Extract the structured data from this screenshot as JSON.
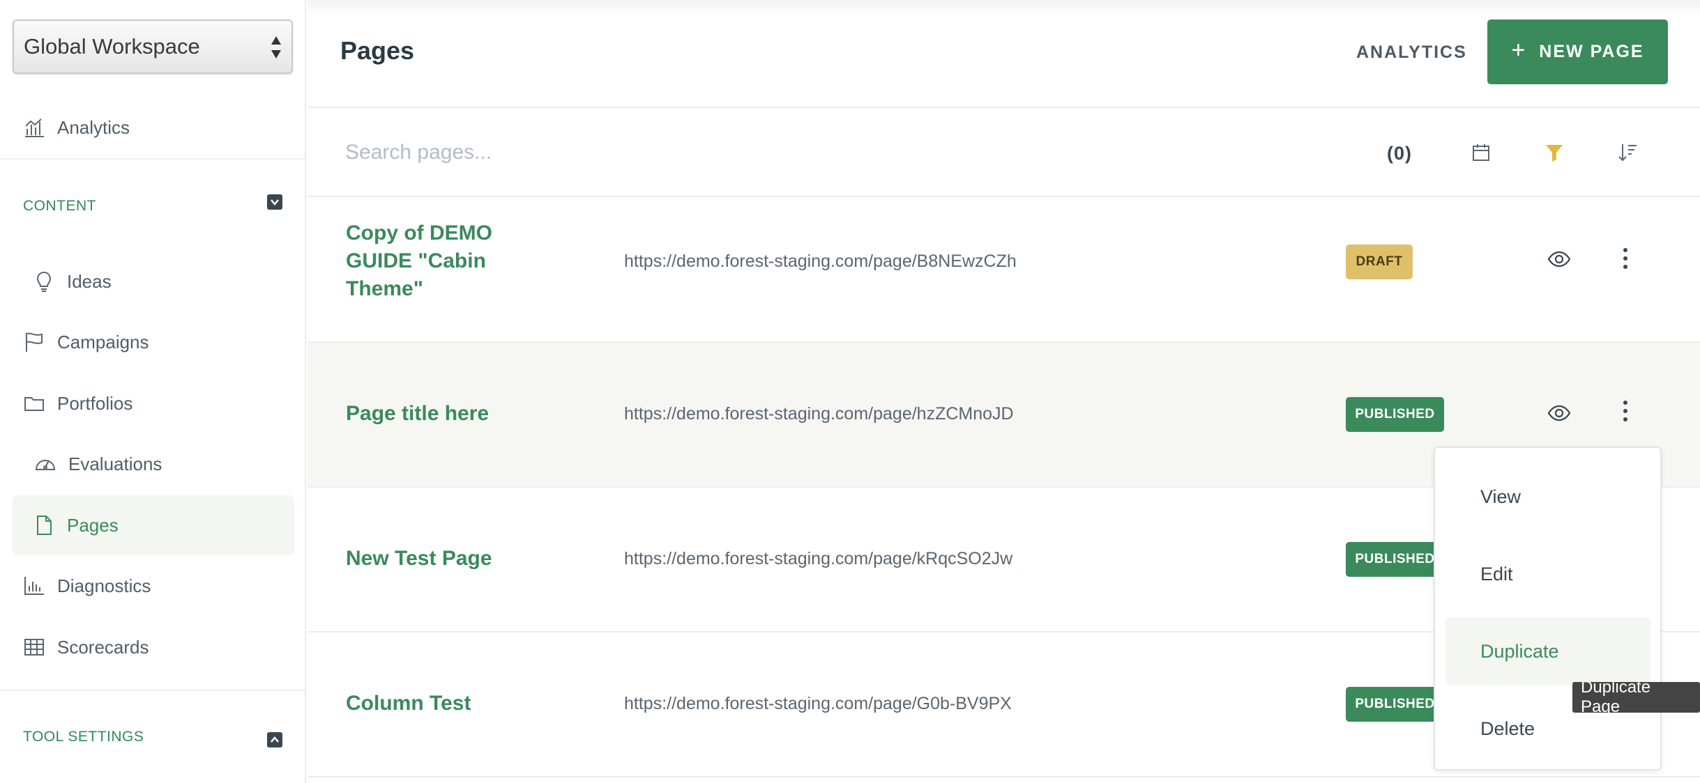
{
  "workspace": {
    "selected": "Global Workspace"
  },
  "sidebar": {
    "analytics": "Analytics",
    "content_section": {
      "label": "CONTENT",
      "state": "collapse"
    },
    "items": [
      {
        "label": "Ideas",
        "icon": "lightbulb-icon"
      },
      {
        "label": "Campaigns",
        "icon": "flag-icon"
      },
      {
        "label": "Portfolios",
        "icon": "folder-icon"
      },
      {
        "label": "Evaluations",
        "icon": "gauge-icon"
      },
      {
        "label": "Pages",
        "icon": "document-icon",
        "active": true
      },
      {
        "label": "Diagnostics",
        "icon": "bar-chart-icon"
      },
      {
        "label": "Scorecards",
        "icon": "table-icon"
      }
    ],
    "tool_settings_section": {
      "label": "TOOL SETTINGS",
      "state": "expand"
    }
  },
  "header": {
    "title": "Pages",
    "analytics_link": "ANALYTICS",
    "new_page_button": "NEW PAGE"
  },
  "search": {
    "placeholder": "Search pages...",
    "count": "(0)"
  },
  "pages": [
    {
      "title_lines": [
        "Copy of DEMO",
        "GUIDE \"Cabin",
        "Theme\""
      ],
      "url": "https://demo.forest-staging.com/page/B8NEwzCZh",
      "status": "DRAFT"
    },
    {
      "title": "Page title here",
      "url": "https://demo.forest-staging.com/page/hzZCMnoJD",
      "status": "PUBLISHED"
    },
    {
      "title": "New Test Page",
      "url": "https://demo.forest-staging.com/page/kRqcSO2Jw",
      "status": "PUBLISHED"
    },
    {
      "title": "Column Test",
      "url": "https://demo.forest-staging.com/page/G0b-BV9PX",
      "status": "PUBLISHED"
    }
  ],
  "row_menu": {
    "items": [
      "View",
      "Edit",
      "Duplicate",
      "Delete"
    ],
    "highlighted": "Duplicate"
  },
  "tooltip": "Duplicate Page",
  "colors": {
    "brand_green": "#3b8a5c",
    "draft_yellow": "#dfc06a",
    "filter_active": "#e0b93a",
    "active_bg": "#f4f6f1"
  }
}
